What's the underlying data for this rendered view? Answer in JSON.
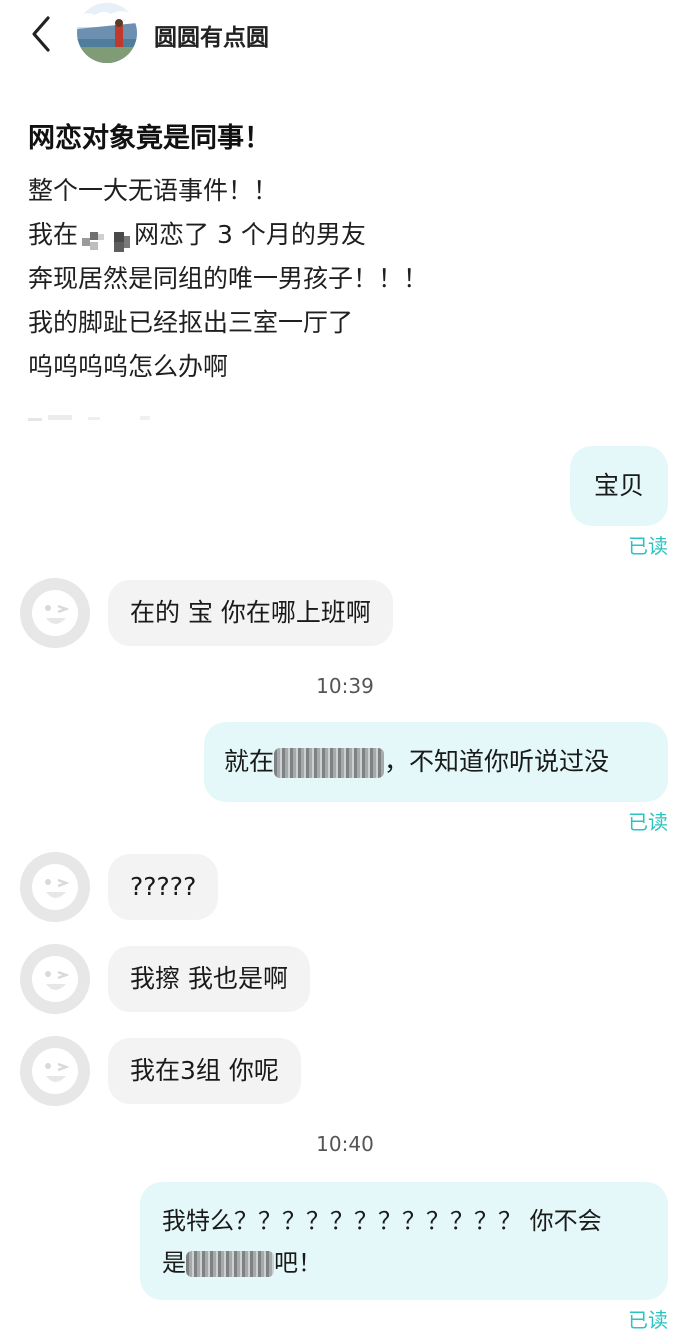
{
  "header": {
    "back_icon": "chevron-left-icon",
    "username": "圆圆有点圆"
  },
  "post": {
    "title": "网恋对象竟是同事！",
    "lines": [
      "整个一大无语事件！！",
      "我在",
      "网恋了 3 个月的男友",
      "奔现居然是同组的唯一男孩子！！！",
      "我的脚趾已经抠出三室一厅了",
      "呜呜呜呜怎么办啊"
    ]
  },
  "chat": {
    "m1": "宝贝",
    "read1": "已读",
    "m2": "在的 宝 你在哪上班啊",
    "time1": "10:39",
    "m3_prefix": "就在",
    "m3_suffix": "，不知道你听说过没",
    "read2": "已读",
    "m4": "?????",
    "m5": "我擦 我也是啊",
    "m6": "我在3组 你呢",
    "time2": "10:40",
    "m7_line1": "我特么？？？？？？？？？？？？ 你不会",
    "m7_line2_prefix": "是",
    "m7_line2_suffix": "吧！",
    "read3": "已读"
  },
  "colors": {
    "accent_read": "#2ac3c0",
    "bubble_self": "#e4f8f9",
    "bubble_other": "#f3f3f3"
  }
}
